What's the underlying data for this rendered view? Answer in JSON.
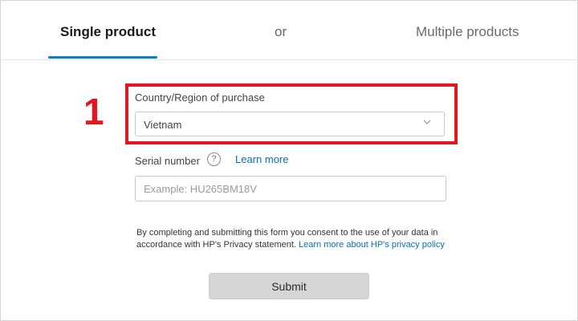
{
  "tabs": {
    "single": "Single product",
    "separator": "or",
    "multiple": "Multiple products"
  },
  "annotation": {
    "step_number": "1"
  },
  "form": {
    "country_label": "Country/Region of purchase",
    "country_value": "Vietnam",
    "serial_label": "Serial number",
    "help_icon": "?",
    "learn_more": "Learn more",
    "serial_placeholder": "Example: HU265BM18V",
    "consent_text": "By completing and submitting this form you consent to the use of your data in accordance with HP's Privacy statement. ",
    "consent_link": "Learn more about HP's privacy policy",
    "submit_label": "Submit"
  },
  "colors": {
    "accent": "#0a7fc1",
    "annotation": "#e3181e",
    "link": "#0a6fb0",
    "button": "#d6d6d6"
  }
}
